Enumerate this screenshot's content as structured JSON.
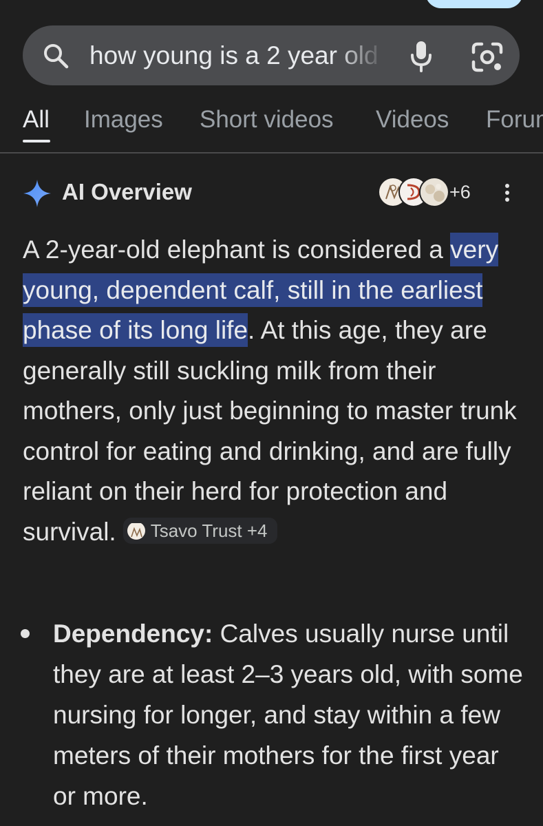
{
  "search": {
    "query": "how young is a 2 year old"
  },
  "tabs": [
    {
      "label": "All",
      "active": true
    },
    {
      "label": "Images",
      "active": false
    },
    {
      "label": "Short videos",
      "active": false
    },
    {
      "label": "Videos",
      "active": false
    },
    {
      "label": "Forums",
      "active": false
    }
  ],
  "ai_overview": {
    "title": "AI Overview",
    "source_count": "+6",
    "intro": "A 2-year-old elephant is considered a ",
    "highlight": "very young, dependent calf, still in the earliest phase of its long life",
    "body": ". At this age, they are generally still suckling milk from their mothers, only just beginning to master trunk control for eating and drinking, and are fully reliant on their herd for protection and survival.",
    "citation": "Tsavo Trust +4"
  },
  "bullets": [
    {
      "title": "Dependency:",
      "text": " Calves usually nurse until they are at least 2–3 years old, with some nursing for longer, and stay within a few meters of their mothers for the first year or more."
    }
  ],
  "colors": {
    "background": "#1f1f1f",
    "search_bar": "#4b4c4f",
    "highlight": "#2e4485",
    "tab_active": "#e8eaed",
    "tab_inactive": "#9aa0a6",
    "sparkle": "#4c8df6"
  },
  "icons": [
    "search-icon",
    "mic-icon",
    "lens-icon",
    "sparkle-icon",
    "more-vert-icon"
  ]
}
